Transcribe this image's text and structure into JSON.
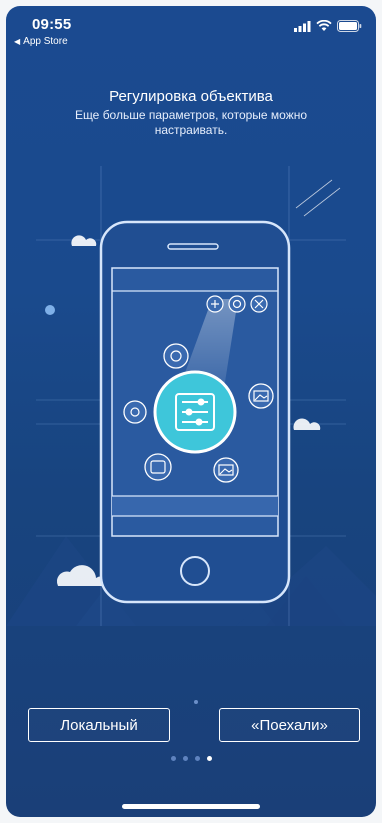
{
  "status_bar": {
    "time": "09:55",
    "back_label": "App Store",
    "icons": [
      "signal-icon",
      "wifi-icon",
      "battery-icon"
    ]
  },
  "onboarding": {
    "title": "Регулировка объектива",
    "subtitle": "Еще больше параметров, которые можно настраивать."
  },
  "buttons": {
    "local_label": "Локальный",
    "go_label": "«Поехали»"
  },
  "pager": {
    "total": 4,
    "active_index": 3
  },
  "colors": {
    "background": "#1b4a90",
    "accent": "#3ec6da",
    "text": "#ffffff"
  }
}
